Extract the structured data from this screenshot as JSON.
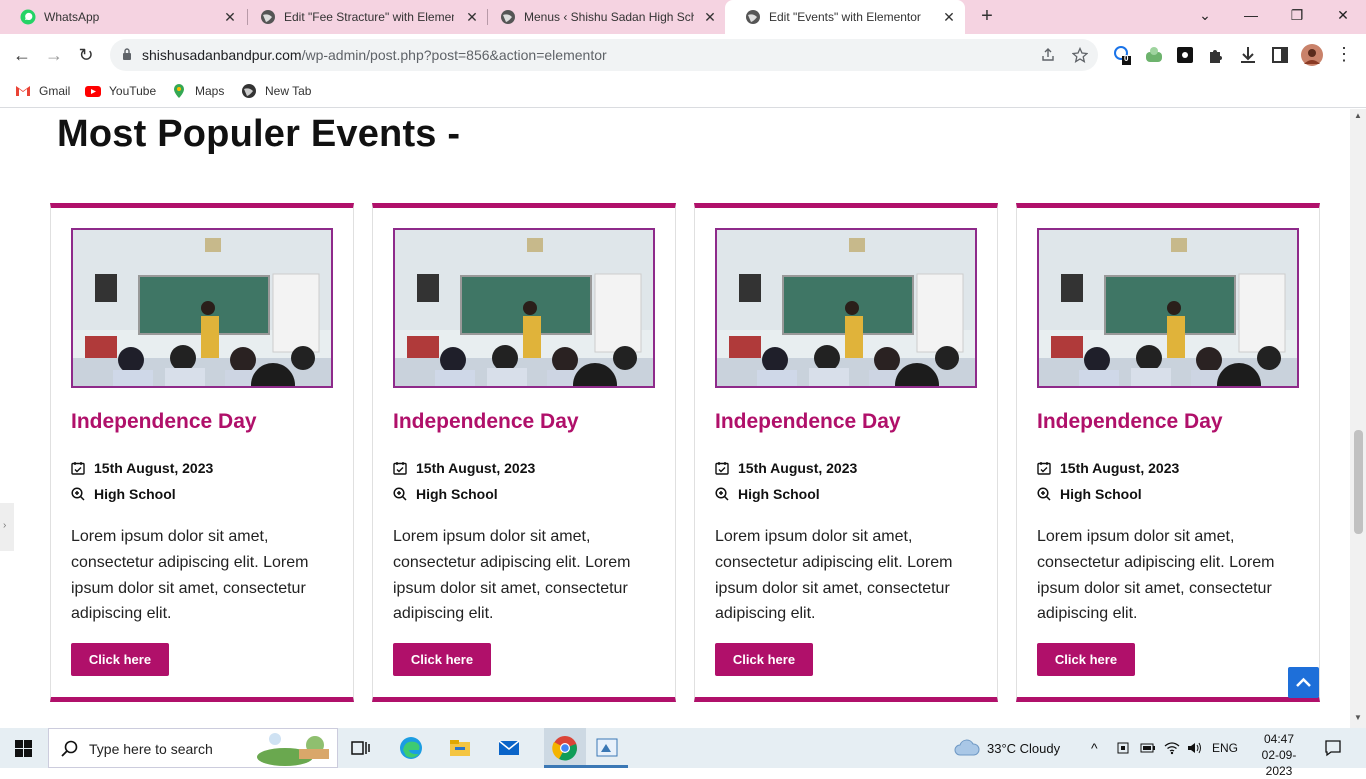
{
  "browser": {
    "tabs": [
      {
        "title": "WhatsApp",
        "icon": "whatsapp-icon",
        "active": false
      },
      {
        "title": "Edit \"Fee Stracture\" with Element",
        "icon": "globe-icon",
        "active": false
      },
      {
        "title": "Menus ‹ Shishu Sadan High Scho",
        "icon": "globe-icon",
        "active": false
      },
      {
        "title": "Edit \"Events\" with Elementor",
        "icon": "globe-icon",
        "active": true
      }
    ],
    "url_host": "shishusadanbandpur.com",
    "url_path": "/wp-admin/post.php?post=856&action=elementor",
    "extension_badge": "0",
    "bookmarks": [
      {
        "label": "Gmail",
        "icon": "gmail-icon"
      },
      {
        "label": "YouTube",
        "icon": "youtube-icon"
      },
      {
        "label": "Maps",
        "icon": "maps-icon"
      },
      {
        "label": "New Tab",
        "icon": "globe-icon"
      }
    ]
  },
  "page": {
    "heading": "Most Populer Events -",
    "accent_color": "#b0106a",
    "cards": [
      {
        "title": "Independence Day",
        "date": "15th August, 2023",
        "category": "High School",
        "description": "Lorem ipsum dolor sit amet, consectetur adipiscing elit. Lorem ipsum dolor sit amet, consectetur adipiscing elit.",
        "button": "Click here"
      },
      {
        "title": "Independence Day",
        "date": "15th August, 2023",
        "category": "High School",
        "description": "Lorem ipsum dolor sit amet, consectetur adipiscing elit. Lorem ipsum dolor sit amet, consectetur adipiscing elit.",
        "button": "Click here"
      },
      {
        "title": "Independence Day",
        "date": "15th August, 2023",
        "category": "High School",
        "description": "Lorem ipsum dolor sit amet, consectetur adipiscing elit. Lorem ipsum dolor sit amet, consectetur adipiscing elit.",
        "button": "Click here"
      },
      {
        "title": "Independence Day",
        "date": "15th August, 2023",
        "category": "High School",
        "description": "Lorem ipsum dolor sit amet, consectetur adipiscing elit. Lorem ipsum dolor sit amet, consectetur adipiscing elit.",
        "button": "Click here"
      }
    ]
  },
  "taskbar": {
    "search_placeholder": "Type here to search",
    "weather": "33°C  Cloudy",
    "language": "ENG",
    "time": "04:47",
    "date": "02-09-2023"
  }
}
